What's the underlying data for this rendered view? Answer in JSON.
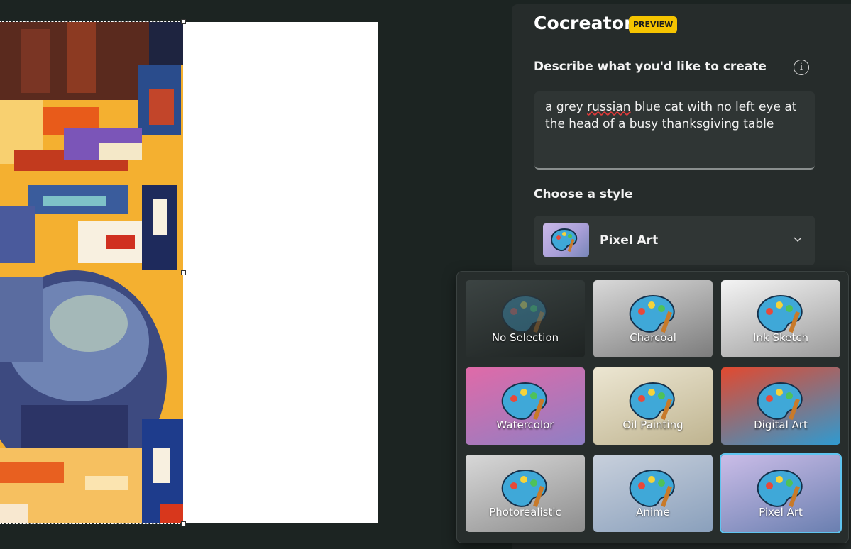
{
  "panel": {
    "title": "Cocreator",
    "badge": "PREVIEW",
    "describe_label": "Describe what you'd like to create",
    "prompt": {
      "before": "a grey ",
      "misspelled": "russian",
      "after": " blue cat with no left eye at the head of a busy thanksgiving table"
    },
    "style_label": "Choose a style",
    "selected_style": "Pixel Art"
  },
  "styles": [
    {
      "label": "No Selection",
      "bg": [
        "#3c4443",
        "#1e2322"
      ]
    },
    {
      "label": "Charcoal",
      "bg": [
        "#d9d9d9",
        "#7c7c7c"
      ]
    },
    {
      "label": "Ink Sketch",
      "bg": [
        "#f4f4f4",
        "#9a9a9a"
      ]
    },
    {
      "label": "Watercolor",
      "bg": [
        "#e06aa8",
        "#8f7fc4"
      ]
    },
    {
      "label": "Oil Painting",
      "bg": [
        "#ece6d2",
        "#bfb490"
      ]
    },
    {
      "label": "Digital Art",
      "bg": [
        "#e2492f",
        "#2f9ad0"
      ]
    },
    {
      "label": "Photorealistic",
      "bg": [
        "#d8d8d8",
        "#8e8e8e"
      ]
    },
    {
      "label": "Anime",
      "bg": [
        "#c8d0dc",
        "#8aa0bc"
      ]
    },
    {
      "label": "Pixel Art",
      "bg": [
        "#cbbde8",
        "#6a7fb0"
      ],
      "selected": true
    }
  ],
  "colors": {
    "accent_selected": "#5fc4f0",
    "badge": "#f5c400",
    "panel_bg": "#262c2b"
  }
}
